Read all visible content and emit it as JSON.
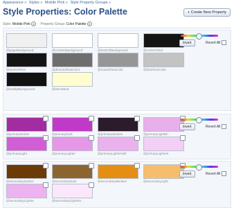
{
  "breadcrumb": [
    "Appearance »",
    "Styles »",
    "Mobile Pink »",
    "Style Property Groups »"
  ],
  "page_title": "Style Properties: Color Palette",
  "create_button_label": "+ Create New Property",
  "filters": {
    "style_label": "Style:",
    "style_value": "Mobile Pink",
    "group_label": "Property Group:",
    "group_value": "Color Palette"
  },
  "tools": {
    "invert_label": "Invert",
    "revert_label": "Revert All",
    "slider_level": 0.5
  },
  "sections": [
    {
      "has_slider": true,
      "swatches": [
        {
          "label": "@pageBackground",
          "color": "#f0f0f0",
          "checkbox": false
        },
        {
          "label": "@contentBackground",
          "color": "#ffffff",
          "checkbox": false
        },
        {
          "label": "@textCtrlBackground",
          "color": "#ffffff",
          "checkbox": false
        },
        {
          "label": "@contentText",
          "color": "#141414",
          "checkbox": false
        },
        {
          "label": "@textCtrlText",
          "color": "#141414",
          "checkbox": false
        },
        {
          "label": "@dimmedTextColor",
          "color": "#6e6e6e",
          "checkbox": false
        },
        {
          "label": "@mutedTextColor",
          "color": "#969696",
          "checkbox": false
        },
        {
          "label": "@faintTextColor",
          "color": "#c3c3c3",
          "checkbox": false
        },
        {
          "label": "@tooltipBackground",
          "color": "#111111",
          "checkbox": false
        },
        {
          "label": "@inlineMod",
          "color": "#fdfdcf",
          "checkbox": false
        }
      ]
    },
    {
      "has_slider": true,
      "swatches": [
        {
          "label": "@primaryDarker",
          "color": "#a12da1",
          "checkbox": true
        },
        {
          "label": "@primaryDark",
          "color": "#c03ac8",
          "checkbox": true
        },
        {
          "label": "@primaryMedium",
          "color": "#2b1b2b",
          "checkbox": true
        },
        {
          "label": "@primaryLightish",
          "color": "#e8b0ea",
          "checkbox": true
        },
        {
          "label": "@primaryLight",
          "color": "#d25ed6",
          "checkbox": true
        },
        {
          "label": "@primaryLighter",
          "color": "#e598e8",
          "checkbox": true
        },
        {
          "label": "@primaryLighterStill",
          "color": "#ebb1ed",
          "checkbox": true
        },
        {
          "label": "@primaryLightest",
          "color": "#f3cff5",
          "checkbox": true
        }
      ]
    },
    {
      "has_slider": true,
      "swatches": [
        {
          "label": "@secondaryDarker",
          "color": "#6b3a06",
          "checkbox": true
        },
        {
          "label": "@secondaryDark",
          "color": "#8c6430",
          "checkbox": true
        },
        {
          "label": "@secondaryMedium",
          "color": "#e58e14",
          "checkbox": true
        },
        {
          "label": "@secondaryLight",
          "color": "#f6be6c",
          "checkbox": true
        },
        {
          "label": "@secondaryLighter",
          "color": "#edb2f0",
          "checkbox": true
        },
        {
          "label": "@secondaryLightest",
          "color": "#fbe7fc",
          "checkbox": true
        }
      ]
    }
  ]
}
